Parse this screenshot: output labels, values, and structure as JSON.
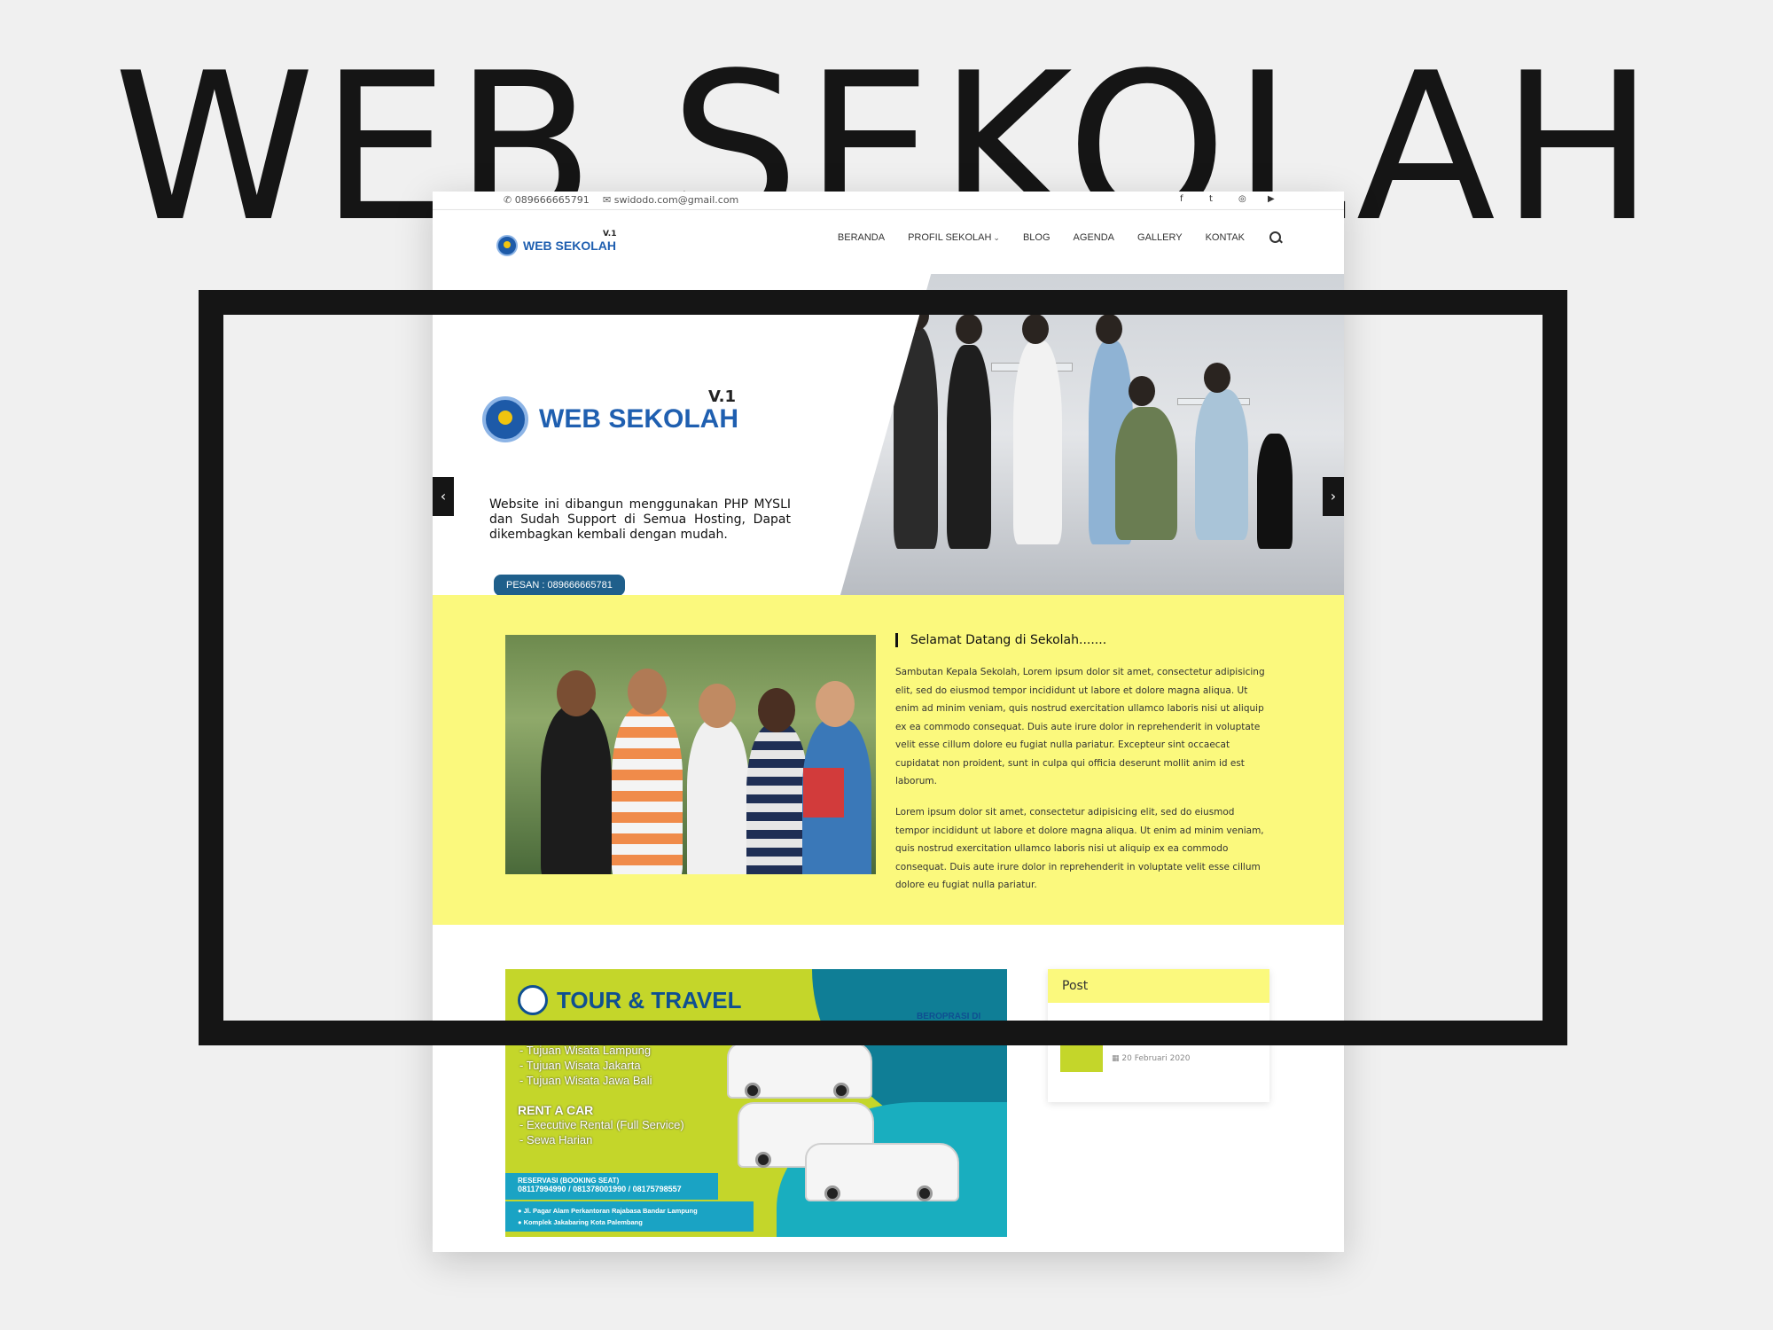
{
  "cover_title": "WEB SEKOLAH",
  "topbar": {
    "phone": "089666665791",
    "email": "swidodo.com@gmail.com",
    "social_icons": [
      "facebook-icon",
      "twitter-icon",
      "instagram-icon",
      "youtube-icon"
    ],
    "social_glyphs": [
      "f",
      "t",
      "◎",
      "▶"
    ]
  },
  "header": {
    "logo_text": "WEB SEKOLAH",
    "logo_version": "V.1",
    "menu": [
      {
        "label": "BERANDA"
      },
      {
        "label": "PROFIL SEKOLAH",
        "has_dropdown": true
      },
      {
        "label": "BLOG"
      },
      {
        "label": "AGENDA"
      },
      {
        "label": "GALLERY"
      },
      {
        "label": "KONTAK"
      }
    ]
  },
  "hero": {
    "logo_text": "WEB SEKOLAH",
    "logo_version": "V.1",
    "description": "Website ini dibangun menggunakan PHP MYSLI dan Sudah Support di Semua Hosting, Dapat dikembagkan kembali dengan mudah.",
    "button_label": "PESAN : 089666665781",
    "prev_arrow": "‹",
    "next_arrow": "›"
  },
  "welcome": {
    "title": "Selamat Datang di Sekolah.......",
    "paragraph1": "Sambutan Kepala Sekolah, Lorem ipsum dolor sit amet, consectetur adipisicing elit, sed do eiusmod tempor incididunt ut labore et dolore magna aliqua. Ut enim ad minim veniam, quis nostrud exercitation ullamco laboris nisi ut aliquip ex ea commodo consequat. Duis aute irure dolor in reprehenderit in voluptate velit esse cillum dolore eu fugiat nulla pariatur. Excepteur sint occaecat cupidatat non proident, sunt in culpa qui officia deserunt mollit anim id est laborum.",
    "paragraph2": "Lorem ipsum dolor sit amet, consectetur adipisicing elit, sed do eiusmod tempor incididunt ut labore et dolore magna aliqua. Ut enim ad minim veniam, quis nostrud exercitation ullamco laboris nisi ut aliquip ex ea commodo consequat. Duis aute irure dolor in reprehenderit in voluptate velit esse cillum dolore eu fugiat nulla pariatur."
  },
  "banner": {
    "title": "TOUR & TRAVEL",
    "corner_text": "BEROPRASI DI",
    "tour_lines": [
      "- Tujuan Wisata Lampung",
      "- Tujuan Wisata Jakarta",
      "- Tujuan Wisata Jawa Bali"
    ],
    "rent_title": "RENT A CAR",
    "rent_lines": [
      "- Executive Rental (Full Service)",
      "- Sewa Harian"
    ],
    "reservation_label": "RESERVASI (BOOKING SEAT)",
    "reservation_phones": "08117994990 / 081378001990 / 08175798557",
    "addresses": [
      "Jl. Pagar Alam Perkantoran Rajabasa Bandar Lampung",
      "Komplek Jakabaring Kota Palembang"
    ]
  },
  "sidebar": {
    "heading": "Post",
    "post_date": "20 Februari 2020"
  },
  "colors": {
    "yellow": "#fbf97d",
    "brand_blue": "#1f5fb0",
    "button_blue": "#1f5f8b",
    "frame": "#151515"
  }
}
